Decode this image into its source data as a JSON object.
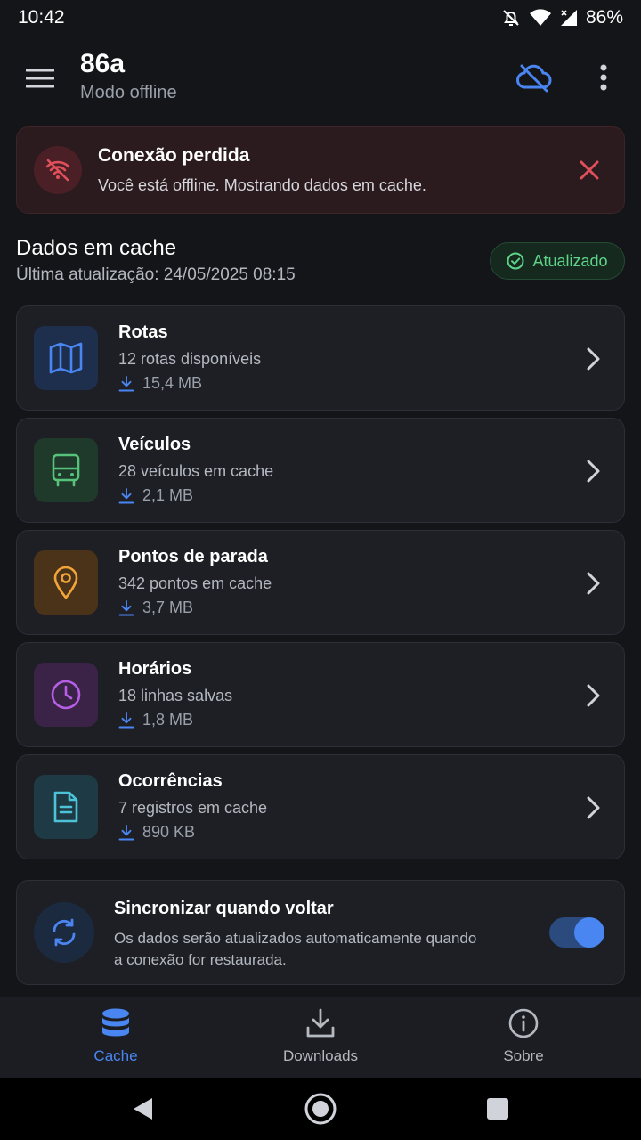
{
  "status_bar": {
    "time": "10:42",
    "battery": "86%"
  },
  "header": {
    "title": "86a",
    "subtitle": "Modo offline"
  },
  "alert": {
    "title": "Conexão perdida",
    "message": "Você está offline. Mostrando dados em cache."
  },
  "section": {
    "title": "Dados em cache",
    "last_update": "Última atualização: 24/05/2025 08:15",
    "badge": "Atualizado"
  },
  "cards": [
    {
      "title": "Rotas",
      "subtitle": "12 rotas disponíveis",
      "size": "15,4 MB",
      "icon": "map-icon",
      "color": "#4a86f2"
    },
    {
      "title": "Veículos",
      "subtitle": "28 veículos em cache",
      "size": "2,1 MB",
      "icon": "bus-icon",
      "color": "#57c27a"
    },
    {
      "title": "Pontos de parada",
      "subtitle": "342 pontos em cache",
      "size": "3,7 MB",
      "icon": "map-pin-icon",
      "color": "#f2a43a"
    },
    {
      "title": "Horários",
      "subtitle": "18 linhas salvas",
      "size": "1,8 MB",
      "icon": "clock-icon",
      "color": "#b65ee6"
    },
    {
      "title": "Ocorrências",
      "subtitle": "7 registros em cache",
      "size": "890 KB",
      "icon": "document-icon",
      "color": "#4cc3d8"
    }
  ],
  "sync": {
    "title": "Sincronizar quando voltar",
    "description": "Os dados serão atualizados automaticamente quando a conexão for restaurada.",
    "enabled": true
  },
  "bottom_nav": {
    "items": [
      {
        "label": "Cache",
        "icon": "database-icon",
        "active": true
      },
      {
        "label": "Downloads",
        "icon": "download-icon",
        "active": false
      },
      {
        "label": "Sobre",
        "icon": "info-icon",
        "active": false
      }
    ]
  },
  "colors": {
    "accent": "#4a86f2",
    "error": "#e0505a",
    "success": "#5fd488",
    "background": "#141519",
    "card": "#1d1f25"
  }
}
